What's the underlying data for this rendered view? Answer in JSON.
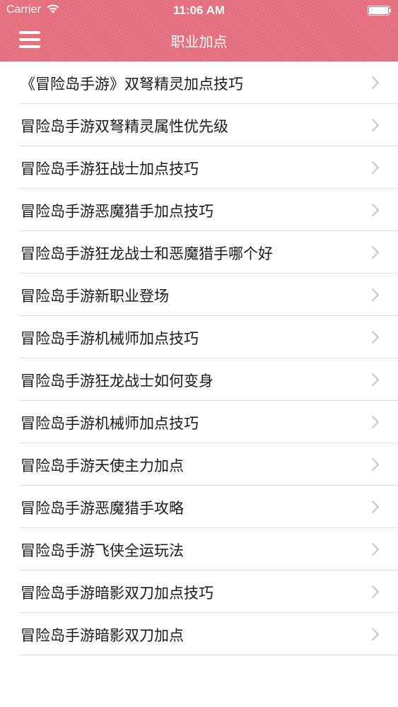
{
  "status_bar": {
    "carrier": "Carrier",
    "time": "11:06 AM"
  },
  "nav": {
    "title": "职业加点",
    "menu_icon": "hamburger-menu-icon"
  },
  "colors": {
    "header": "#e8707f",
    "separator": "#dcdcdc",
    "chevron": "#c7c7cc"
  },
  "items": [
    {
      "label": "《冒险岛手游》双弩精灵加点技巧"
    },
    {
      "label": "冒险岛手游双弩精灵属性优先级"
    },
    {
      "label": "冒险岛手游狂战士加点技巧"
    },
    {
      "label": "冒险岛手游恶魔猎手加点技巧"
    },
    {
      "label": "冒险岛手游狂龙战士和恶魔猎手哪个好"
    },
    {
      "label": "冒险岛手游新职业登场"
    },
    {
      "label": "冒险岛手游机械师加点技巧"
    },
    {
      "label": "冒险岛手游狂龙战士如何变身"
    },
    {
      "label": "冒险岛手游机械师加点技巧"
    },
    {
      "label": "冒险岛手游天使主力加点"
    },
    {
      "label": "冒险岛手游恶魔猎手攻略"
    },
    {
      "label": "冒险岛手游飞侠全运玩法"
    },
    {
      "label": "冒险岛手游暗影双刀加点技巧"
    },
    {
      "label": "冒险岛手游暗影双刀加点"
    }
  ]
}
